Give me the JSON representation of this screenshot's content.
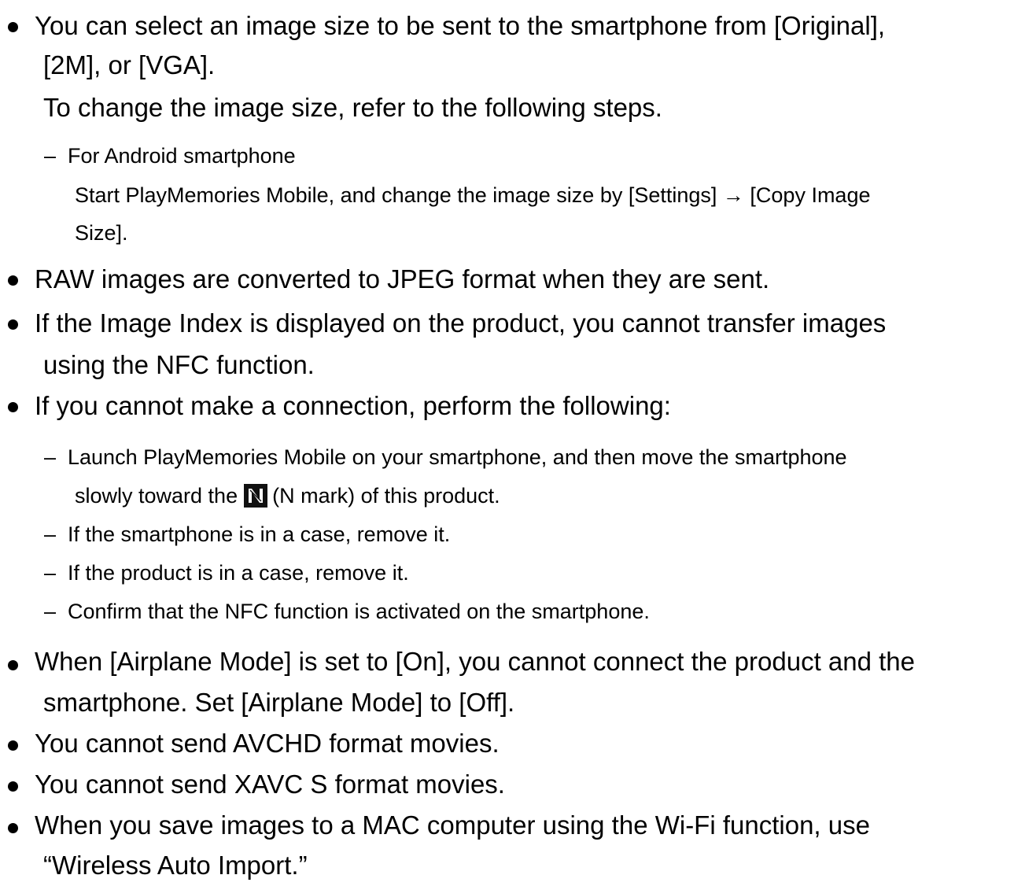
{
  "bullets": {
    "b1": {
      "line1": "You can select an image size to be sent to the smartphone from [Original],",
      "line2": "[2M], or [VGA].",
      "line3": "To change the image size, refer to the following steps.",
      "sub1": {
        "dash": "–",
        "line1": "For Android smartphone",
        "line2": "Start PlayMemories Mobile, and change the image size by [Settings] → [Copy Image",
        "line3": "Size]."
      }
    },
    "b2": {
      "line1": "RAW images are converted to JPEG format when they are sent."
    },
    "b3": {
      "line1": "If the Image Index is displayed on the product, you cannot transfer images",
      "line2": "using the NFC function."
    },
    "b4": {
      "line1": "If you cannot make a connection, perform the following:",
      "subs": [
        {
          "dash": "–",
          "line1": "Launch PlayMemories Mobile on your smartphone, and then move the smartphone",
          "line2_before": "slowly toward the",
          "line2_after": "(N mark) of this product."
        },
        {
          "dash": "–",
          "line1": "If the smartphone is in a case, remove it."
        },
        {
          "dash": "–",
          "line1": "If the product is in a case, remove it."
        },
        {
          "dash": "–",
          "line1": "Confirm that the NFC function is activated on the smartphone."
        }
      ]
    },
    "b5": {
      "line1": "When [Airplane Mode] is set to [On], you cannot connect the product and the",
      "line2": "smartphone. Set [Airplane Mode] to [Off]."
    },
    "b6": {
      "line1": "You cannot send AVCHD format movies."
    },
    "b7": {
      "line1": "You cannot send XAVC S format movies."
    },
    "b8": {
      "line1": "When you save images to a MAC computer using the Wi-Fi function, use",
      "line2": "“Wireless Auto Import.”"
    }
  },
  "icons": {
    "bullet": "bullet-dot",
    "nfc": "n-mark-icon"
  }
}
